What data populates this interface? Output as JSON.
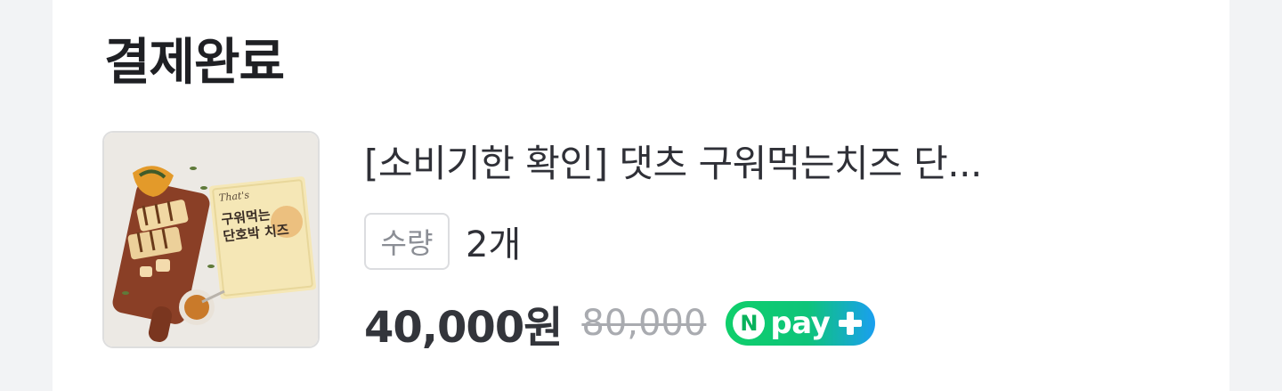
{
  "header": {
    "title": "결제완료"
  },
  "product": {
    "image_name": "product-thumbnail",
    "name": "[소비기한 확인] 댓츠 구워먹는치즈 단...",
    "quantity_label": "수량",
    "quantity_value": "2개",
    "price": "40,000원",
    "original_price": "80,000",
    "badge": {
      "letter": "N",
      "text": "pay",
      "icon": "plus-icon"
    },
    "thumbnail_text": {
      "brand": "That's",
      "package_line1": "구워먹는",
      "package_line2": "단호박 치즈"
    }
  },
  "colors": {
    "npay_green": "#0fcf6b",
    "npay_blue": "#1a9ff0",
    "card_bg": "#ffffff",
    "page_bg": "#f2f3f5"
  }
}
